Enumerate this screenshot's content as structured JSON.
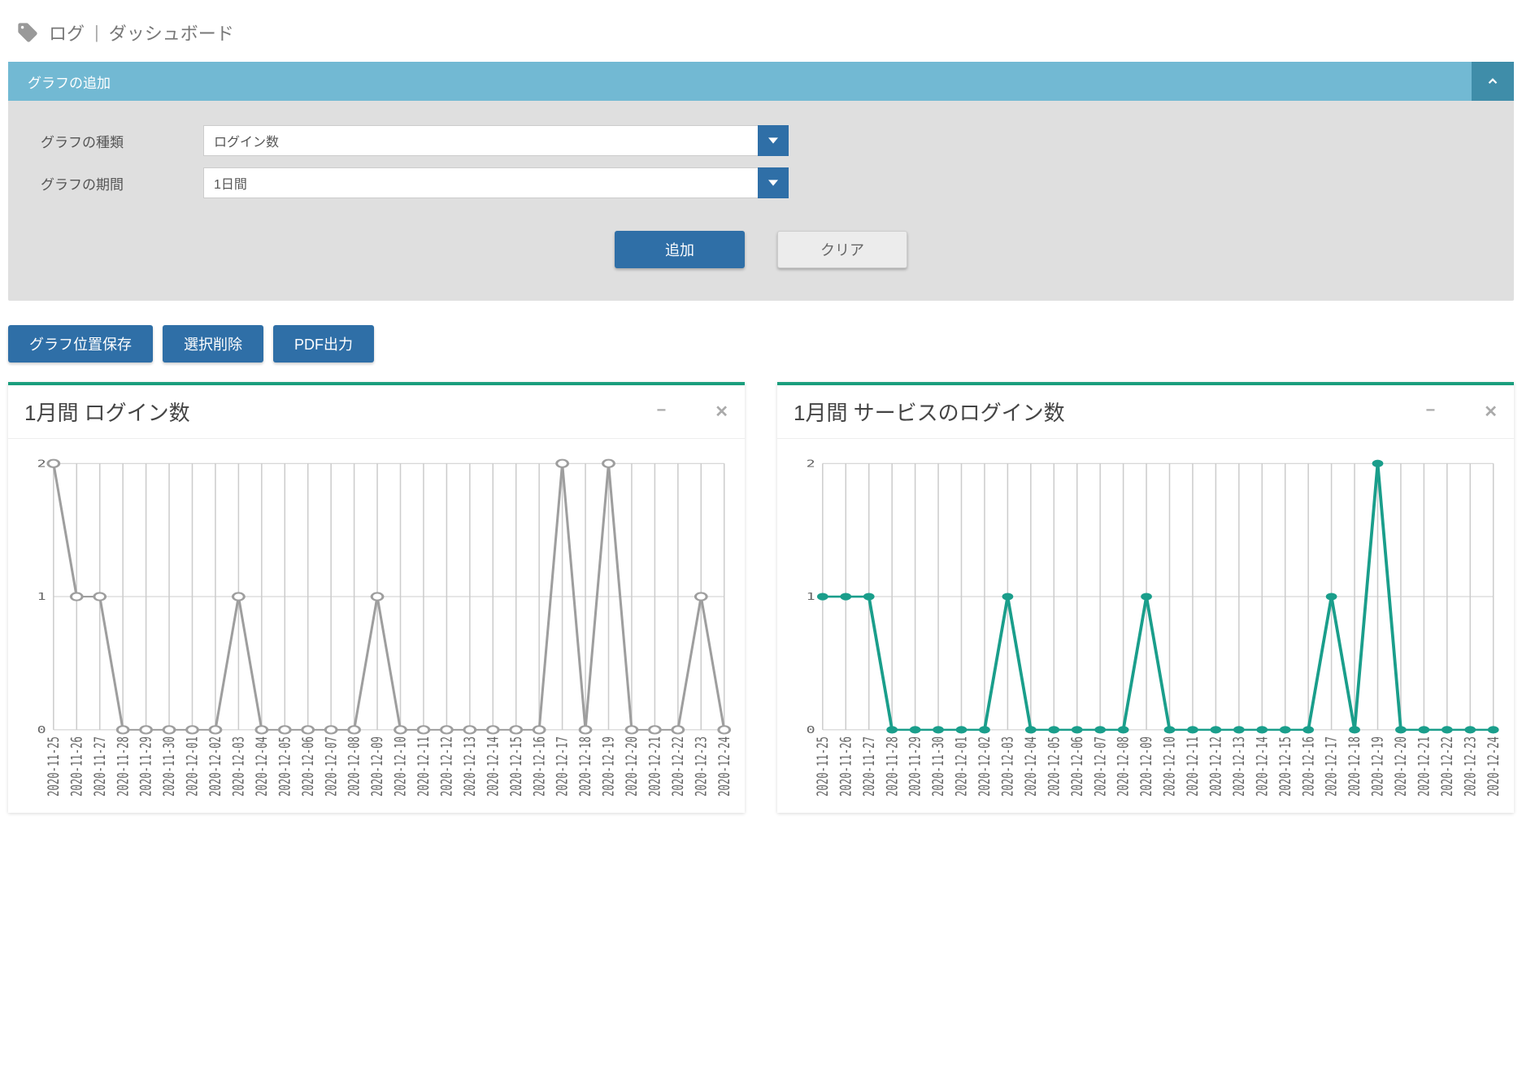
{
  "breadcrumb": {
    "item1": "ログ",
    "item2": "ダッシュボード"
  },
  "panel": {
    "title": "グラフの追加",
    "type_label": "グラフの種類",
    "type_value": "ログイン数",
    "period_label": "グラフの期間",
    "period_value": "1日間",
    "add_label": "追加",
    "clear_label": "クリア"
  },
  "actions": {
    "save_pos": "グラフ位置保存",
    "delete_sel": "選択削除",
    "pdf": "PDF出力"
  },
  "charts": [
    {
      "title": "1月間 ログイン数",
      "style": "gray",
      "x": [
        "2020-11-25",
        "2020-11-26",
        "2020-11-27",
        "2020-11-28",
        "2020-11-29",
        "2020-11-30",
        "2020-12-01",
        "2020-12-02",
        "2020-12-03",
        "2020-12-04",
        "2020-12-05",
        "2020-12-06",
        "2020-12-07",
        "2020-12-08",
        "2020-12-09",
        "2020-12-10",
        "2020-12-11",
        "2020-12-12",
        "2020-12-13",
        "2020-12-14",
        "2020-12-15",
        "2020-12-16",
        "2020-12-17",
        "2020-12-18",
        "2020-12-19",
        "2020-12-20",
        "2020-12-21",
        "2020-12-22",
        "2020-12-23",
        "2020-12-24"
      ],
      "y": [
        2,
        1,
        1,
        0,
        0,
        0,
        0,
        0,
        1,
        0,
        0,
        0,
        0,
        0,
        1,
        0,
        0,
        0,
        0,
        0,
        0,
        0,
        2,
        0,
        2,
        0,
        0,
        0,
        1,
        0
      ]
    },
    {
      "title": "1月間 サービスのログイン数",
      "style": "teal",
      "x": [
        "2020-11-25",
        "2020-11-26",
        "2020-11-27",
        "2020-11-28",
        "2020-11-29",
        "2020-11-30",
        "2020-12-01",
        "2020-12-02",
        "2020-12-03",
        "2020-12-04",
        "2020-12-05",
        "2020-12-06",
        "2020-12-07",
        "2020-12-08",
        "2020-12-09",
        "2020-12-10",
        "2020-12-11",
        "2020-12-12",
        "2020-12-13",
        "2020-12-14",
        "2020-12-15",
        "2020-12-16",
        "2020-12-17",
        "2020-12-18",
        "2020-12-19",
        "2020-12-20",
        "2020-12-21",
        "2020-12-22",
        "2020-12-23",
        "2020-12-24"
      ],
      "y": [
        1,
        1,
        1,
        0,
        0,
        0,
        0,
        0,
        1,
        0,
        0,
        0,
        0,
        0,
        1,
        0,
        0,
        0,
        0,
        0,
        0,
        0,
        1,
        0,
        2,
        0,
        0,
        0,
        0,
        0
      ]
    }
  ],
  "chart_data": [
    {
      "type": "line",
      "title": "1月間 ログイン数",
      "xlabel": "",
      "ylabel": "",
      "ylim": [
        0,
        2
      ],
      "categories": [
        "2020-11-25",
        "2020-11-26",
        "2020-11-27",
        "2020-11-28",
        "2020-11-29",
        "2020-11-30",
        "2020-12-01",
        "2020-12-02",
        "2020-12-03",
        "2020-12-04",
        "2020-12-05",
        "2020-12-06",
        "2020-12-07",
        "2020-12-08",
        "2020-12-09",
        "2020-12-10",
        "2020-12-11",
        "2020-12-12",
        "2020-12-13",
        "2020-12-14",
        "2020-12-15",
        "2020-12-16",
        "2020-12-17",
        "2020-12-18",
        "2020-12-19",
        "2020-12-20",
        "2020-12-21",
        "2020-12-22",
        "2020-12-23",
        "2020-12-24"
      ],
      "values": [
        2,
        1,
        1,
        0,
        0,
        0,
        0,
        0,
        1,
        0,
        0,
        0,
        0,
        0,
        1,
        0,
        0,
        0,
        0,
        0,
        0,
        0,
        2,
        0,
        2,
        0,
        0,
        0,
        1,
        0
      ]
    },
    {
      "type": "line",
      "title": "1月間 サービスのログイン数",
      "xlabel": "",
      "ylabel": "",
      "ylim": [
        0,
        2
      ],
      "categories": [
        "2020-11-25",
        "2020-11-26",
        "2020-11-27",
        "2020-11-28",
        "2020-11-29",
        "2020-11-30",
        "2020-12-01",
        "2020-12-02",
        "2020-12-03",
        "2020-12-04",
        "2020-12-05",
        "2020-12-06",
        "2020-12-07",
        "2020-12-08",
        "2020-12-09",
        "2020-12-10",
        "2020-12-11",
        "2020-12-12",
        "2020-12-13",
        "2020-12-14",
        "2020-12-15",
        "2020-12-16",
        "2020-12-17",
        "2020-12-18",
        "2020-12-19",
        "2020-12-20",
        "2020-12-21",
        "2020-12-22",
        "2020-12-23",
        "2020-12-24"
      ],
      "values": [
        1,
        1,
        1,
        0,
        0,
        0,
        0,
        0,
        1,
        0,
        0,
        0,
        0,
        0,
        1,
        0,
        0,
        0,
        0,
        0,
        0,
        0,
        1,
        0,
        2,
        0,
        0,
        0,
        0,
        0
      ]
    }
  ]
}
